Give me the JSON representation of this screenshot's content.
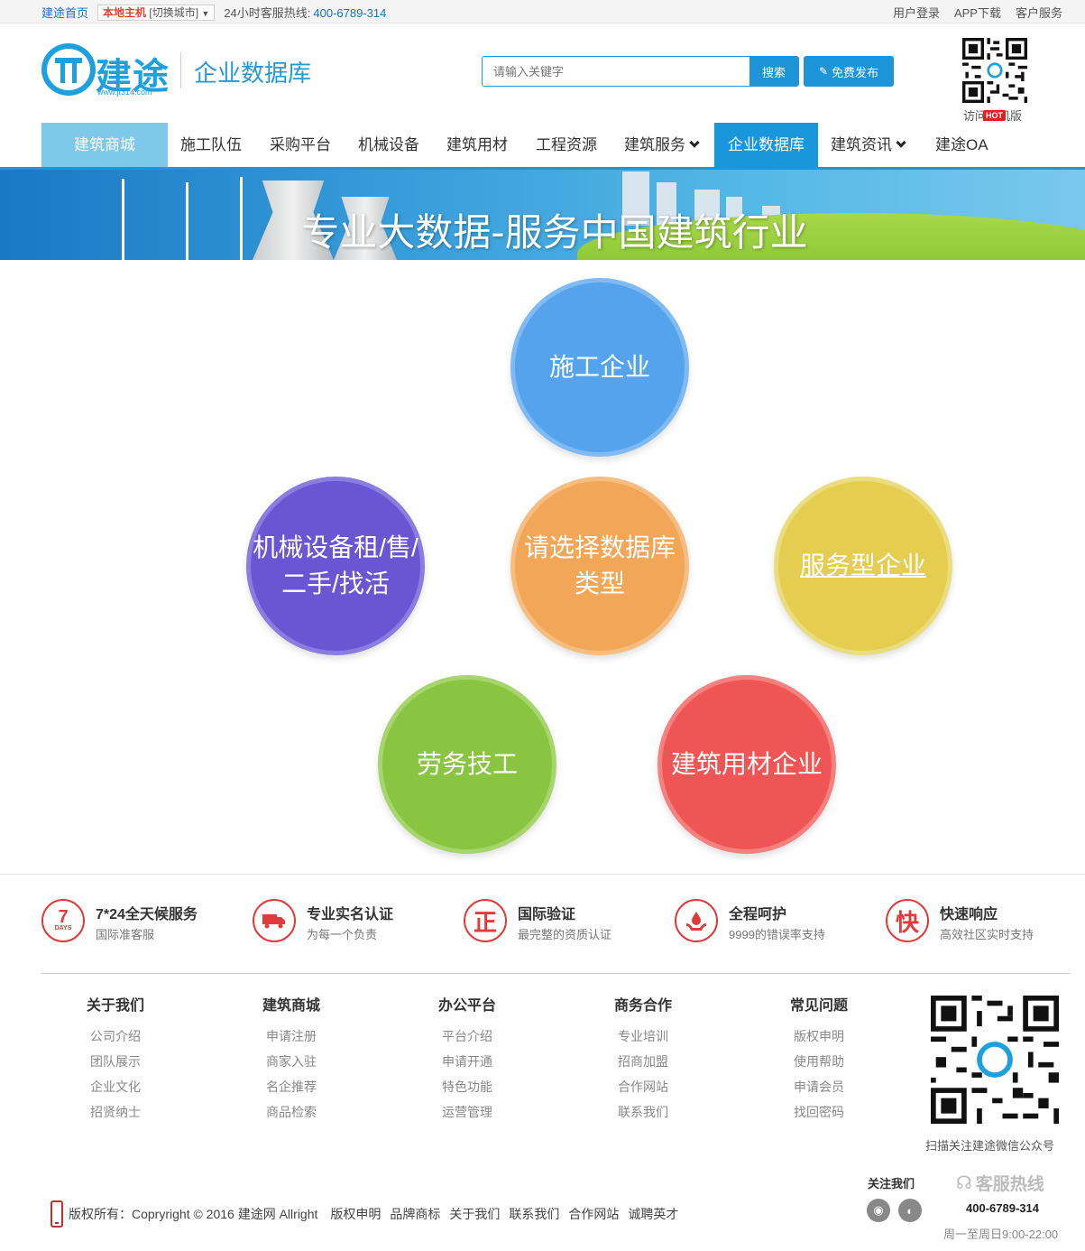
{
  "topbar": {
    "home": "建途首页",
    "city_current": "本地主机",
    "city_switch": "[切换城市]",
    "hotline_label": "24小时客服热线:",
    "hotline_phone": "400-6789-314",
    "right_links": [
      "用户登录",
      "APP下载",
      "客户服务"
    ]
  },
  "header": {
    "logo_text": "建途",
    "logo_url": "www.jt314.com",
    "site_name": "企业数据库",
    "search_placeholder": "请输入关键字",
    "search_button": "搜索",
    "publish_button": "免费发布",
    "qr_caption": "访问手机版",
    "hot_badge": "HOT"
  },
  "nav": {
    "items": [
      {
        "label": "建筑商城"
      },
      {
        "label": "施工队伍"
      },
      {
        "label": "采购平台"
      },
      {
        "label": "机械设备"
      },
      {
        "label": "建筑用材"
      },
      {
        "label": "工程资源"
      },
      {
        "label": "建筑服务"
      },
      {
        "label": "企业数据库"
      },
      {
        "label": "建筑资讯"
      },
      {
        "label": "建途OA"
      }
    ],
    "active": "企业数据库"
  },
  "banner": {
    "title": "专业大数据-服务中国建筑行业"
  },
  "circles": {
    "construction": "施工企业",
    "machinery_line1": "机械设备租/售/",
    "machinery_line2": "二手/找活",
    "choose_line1": "请选择数据库",
    "choose_line2": "类型",
    "service": "服务型企业",
    "labor": "劳务技工",
    "materials": "建筑用材企业",
    "colors": {
      "blue": "#54a3ec",
      "purple": "#6a55d3",
      "orange": "#f2a657",
      "yellow": "#e4cd4f",
      "green": "#89c540",
      "red": "#f05555"
    }
  },
  "features": [
    {
      "icon": "7",
      "icon_sub": "DAYS",
      "title": "7*24全天候服务",
      "desc": "国际准客服"
    },
    {
      "icon": "truck",
      "title": "专业实名认证",
      "desc": "为每一个负责"
    },
    {
      "icon": "正",
      "title": "国际验证",
      "desc": "最完整的资质认证"
    },
    {
      "icon": "hand-drop",
      "title": "全程呵护",
      "desc": "9999的错误率支持"
    },
    {
      "icon": "快",
      "title": "快速响应",
      "desc": "高效社区实时支持"
    }
  ],
  "footer_cols": [
    {
      "title": "关于我们",
      "links": [
        "公司介绍",
        "团队展示",
        "企业文化",
        "招贤纳士"
      ]
    },
    {
      "title": "建筑商城",
      "links": [
        "申请注册",
        "商家入驻",
        "名企推荐",
        "商品检索"
      ]
    },
    {
      "title": "办公平台",
      "links": [
        "平台介绍",
        "申请开通",
        "特色功能",
        "运营管理"
      ]
    },
    {
      "title": "商务合作",
      "links": [
        "专业培训",
        "招商加盟",
        "合作网站",
        "联系我们"
      ]
    },
    {
      "title": "常见问题",
      "links": [
        "版权申明",
        "使用帮助",
        "申请会员",
        "找回密码"
      ]
    }
  ],
  "footer": {
    "qr_caption": "扫描关注建途微信公众号",
    "follow": "关注我们",
    "service_title": "客服热线",
    "service_phone": "400-6789-314",
    "service_hours": "周一至周日9:00-22:00",
    "copyright": "版权所有：Copryright © 2016 建途网 Allright",
    "links": [
      "版权申明",
      "品牌商标",
      "关于我们",
      "联系我们",
      "合作网站",
      "诚聘英才"
    ]
  }
}
